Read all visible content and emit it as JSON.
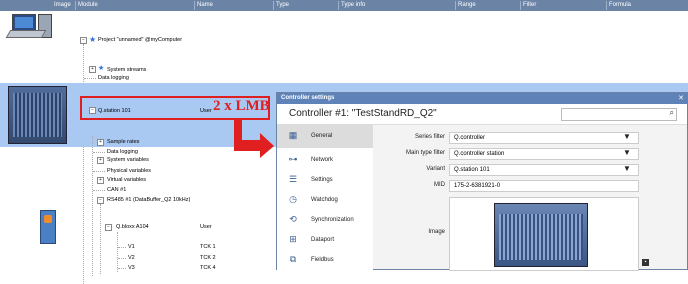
{
  "header": {
    "columns": [
      "Image",
      "Module",
      "Name",
      "Type",
      "Type info",
      "Range",
      "Filter",
      "Formula"
    ]
  },
  "tree": {
    "project": "Project \"unnamed\" @myComputer",
    "system_streams": "System streams",
    "data_logging": "Data logging",
    "station_module": "Q.station 101",
    "station_type": "User",
    "sample_rates": "Sample rates",
    "data_logging2": "Data logging",
    "system_variables": "System variables",
    "physical_variables": "Physical variables",
    "virtual_variables": "Virtual variables",
    "can": "CAN #1",
    "rs485": "RS485 #1 (DataBuffer_Q2 10kHz)",
    "bloxx_module": "Q.bloxx A104",
    "bloxx_type": "User",
    "channels": [
      {
        "name": "V1",
        "type": "TCK 1"
      },
      {
        "name": "V2",
        "type": "TCK 2"
      },
      {
        "name": "V3",
        "type": "TCK 4"
      }
    ]
  },
  "annotation": {
    "label": "2 x LMB",
    "colors": {
      "red": "#e02020"
    }
  },
  "dialog": {
    "window_title": "Controller settings",
    "heading": "Controller #1: \"TestStandRD_Q2\"",
    "nav": [
      {
        "label": "General",
        "icon": "general-icon"
      },
      {
        "label": "Network",
        "icon": "network-icon"
      },
      {
        "label": "Settings",
        "icon": "settings-icon"
      },
      {
        "label": "Watchdog",
        "icon": "watchdog-icon"
      },
      {
        "label": "Synchronization",
        "icon": "synchronization-icon"
      },
      {
        "label": "Dataport",
        "icon": "dataport-icon"
      },
      {
        "label": "Fieldbus",
        "icon": "fieldbus-icon"
      }
    ],
    "form": {
      "series_filter_label": "Series filter",
      "series_filter_value": "Q.controller",
      "main_type_filter_label": "Main type filter",
      "main_type_filter_value": "Q.controller station",
      "variant_label": "Variant",
      "variant_value": "Q.station 101",
      "mid_label": "MID",
      "mid_value": "175-2-6381921-0",
      "image_label": "Image"
    }
  },
  "colors": {
    "header": "#6b84a6",
    "selection": "#a9c8f2",
    "dialog_title": "#5f83b8"
  }
}
